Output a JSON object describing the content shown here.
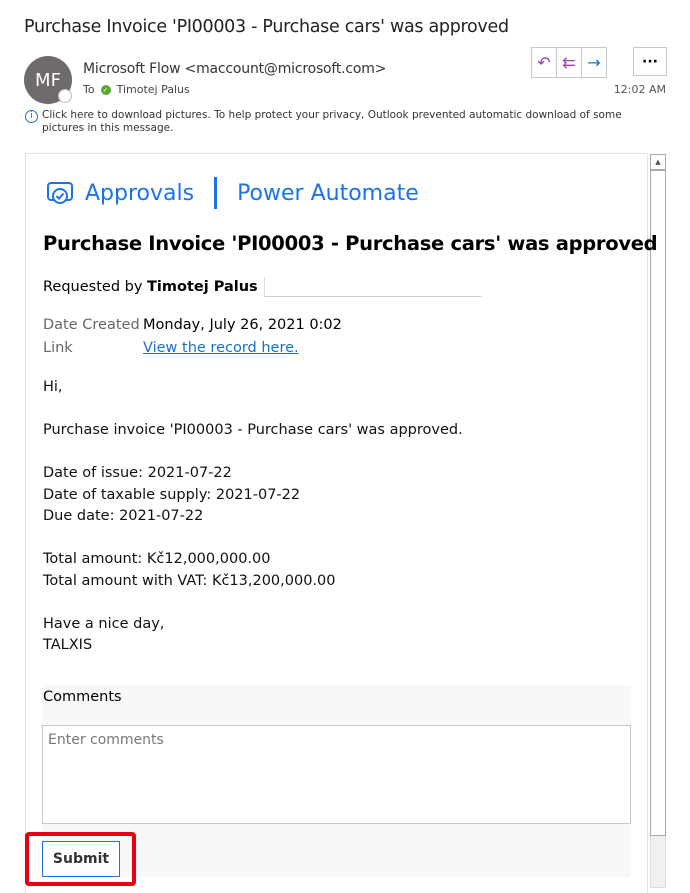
{
  "email": {
    "subject": "Purchase Invoice 'PI00003 - Purchase cars' was approved",
    "avatar_initials": "MF",
    "sender": "Microsoft Flow <maccount@microsoft.com>",
    "to_label": "To",
    "recipient": "Timotej Palus",
    "time": "12:02 AM",
    "info_bar": "Click here to download pictures. To help protect your privacy, Outlook prevented automatic download of some pictures in this message.",
    "actions": [
      {
        "icon": "reply-icon",
        "glyph": "↶"
      },
      {
        "icon": "reply-all-icon",
        "glyph": "⇇"
      },
      {
        "icon": "forward-icon",
        "glyph": "→"
      }
    ],
    "more_glyph": "···",
    "accent": "#1a73e8",
    "reply_color": "#9b3fb5"
  },
  "card": {
    "brand_app": "Approvals",
    "brand_product": "Power Automate",
    "title": "Purchase Invoice 'PI00003 - Purchase cars' was approved",
    "requested_by_label": "Requested by",
    "requested_by": "Timotej Palus",
    "date_created_label": "Date Created",
    "date_created": "Monday, July 26, 2021 0:02",
    "link_label": "Link",
    "link_text": "View the record here.",
    "body": "Hi,\n\nPurchase invoice 'PI00003 - Purchase cars' was approved.\n\nDate of issue: 2021-07-22\nDate of taxable supply: 2021-07-22\nDue date: 2021-07-22\n\nTotal amount: Kč12,000,000.00\nTotal amount with VAT: Kč13,200,000.00\n\nHave a nice day,\nTALXIS",
    "comments_label": "Comments",
    "comments_placeholder": "Enter comments",
    "submit_label": "Submit"
  }
}
